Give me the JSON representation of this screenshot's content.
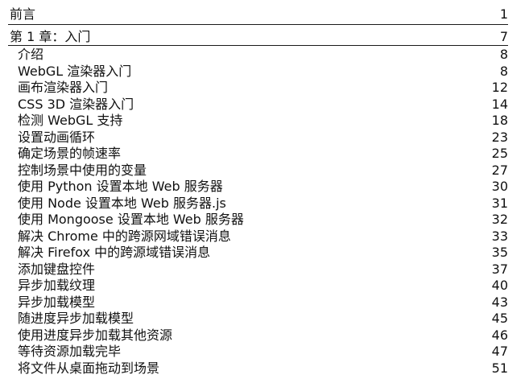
{
  "toc": {
    "preface": {
      "title": "前言",
      "page": "1"
    },
    "chapter": {
      "title": "第 1 章：入门",
      "page": "7"
    },
    "sections": [
      {
        "title": "介绍",
        "page": "8"
      },
      {
        "title": "WebGL 渲染器入门",
        "page": "8"
      },
      {
        "title": "画布渲染器入门",
        "page": "12"
      },
      {
        "title": "CSS 3D 渲染器入门",
        "page": "14"
      },
      {
        "title": "检测 WebGL 支持",
        "page": "18"
      },
      {
        "title": "设置动画循环",
        "page": "23"
      },
      {
        "title": "确定场景的帧速率",
        "page": "25"
      },
      {
        "title": "控制场景中使用的变量",
        "page": "27"
      },
      {
        "title": "使用 Python 设置本地 Web 服务器",
        "page": "30"
      },
      {
        "title": "使用 Node 设置本地 Web 服务器.js",
        "page": "31"
      },
      {
        "title": "使用 Mongoose 设置本地 Web 服务器",
        "page": "32"
      },
      {
        "title": "解决 Chrome 中的跨源网域错误消息",
        "page": "33"
      },
      {
        "title": "解决 Firefox 中的跨源域错误消息",
        "page": "35"
      },
      {
        "title": "添加键盘控件",
        "page": "37"
      },
      {
        "title": "异步加载纹理",
        "page": "40"
      },
      {
        "title": "异步加载模型",
        "page": "43"
      },
      {
        "title": "随进度异步加载模型",
        "page": "45"
      },
      {
        "title": "使用进度异步加载其他资源",
        "page": "46"
      },
      {
        "title": "等待资源加载完毕",
        "page": "47"
      },
      {
        "title": "将文件从桌面拖动到场景",
        "page": "51"
      }
    ]
  }
}
